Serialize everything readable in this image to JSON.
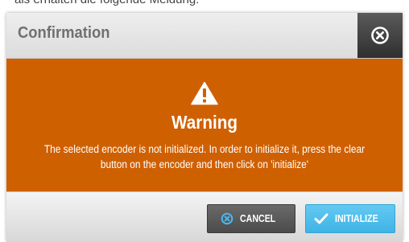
{
  "page_fragment": "als erhalten die folgende Meldung:",
  "dialog": {
    "title": "Confirmation",
    "close_icon": "close-circle-icon",
    "warning": {
      "icon": "warning-triangle-icon",
      "heading": "Warning",
      "message": "The selected encoder is not initialized. In order to initialize it, press the clear button on the encoder and then click on 'initialize'"
    },
    "buttons": {
      "cancel": {
        "label": "CANCEL",
        "icon": "cancel-circle-icon"
      },
      "initialize": {
        "label": "INITIALIZE",
        "icon": "checkmark-icon"
      }
    }
  },
  "colors": {
    "warning_banner": "#cf6000",
    "header_bg": "#e3e3e3",
    "close_box_bg": "#3e3e3e",
    "cancel_button_bg": "#585858",
    "initialize_button_bg": "#4fbdeb",
    "cancel_icon_color": "#49b8ee"
  }
}
